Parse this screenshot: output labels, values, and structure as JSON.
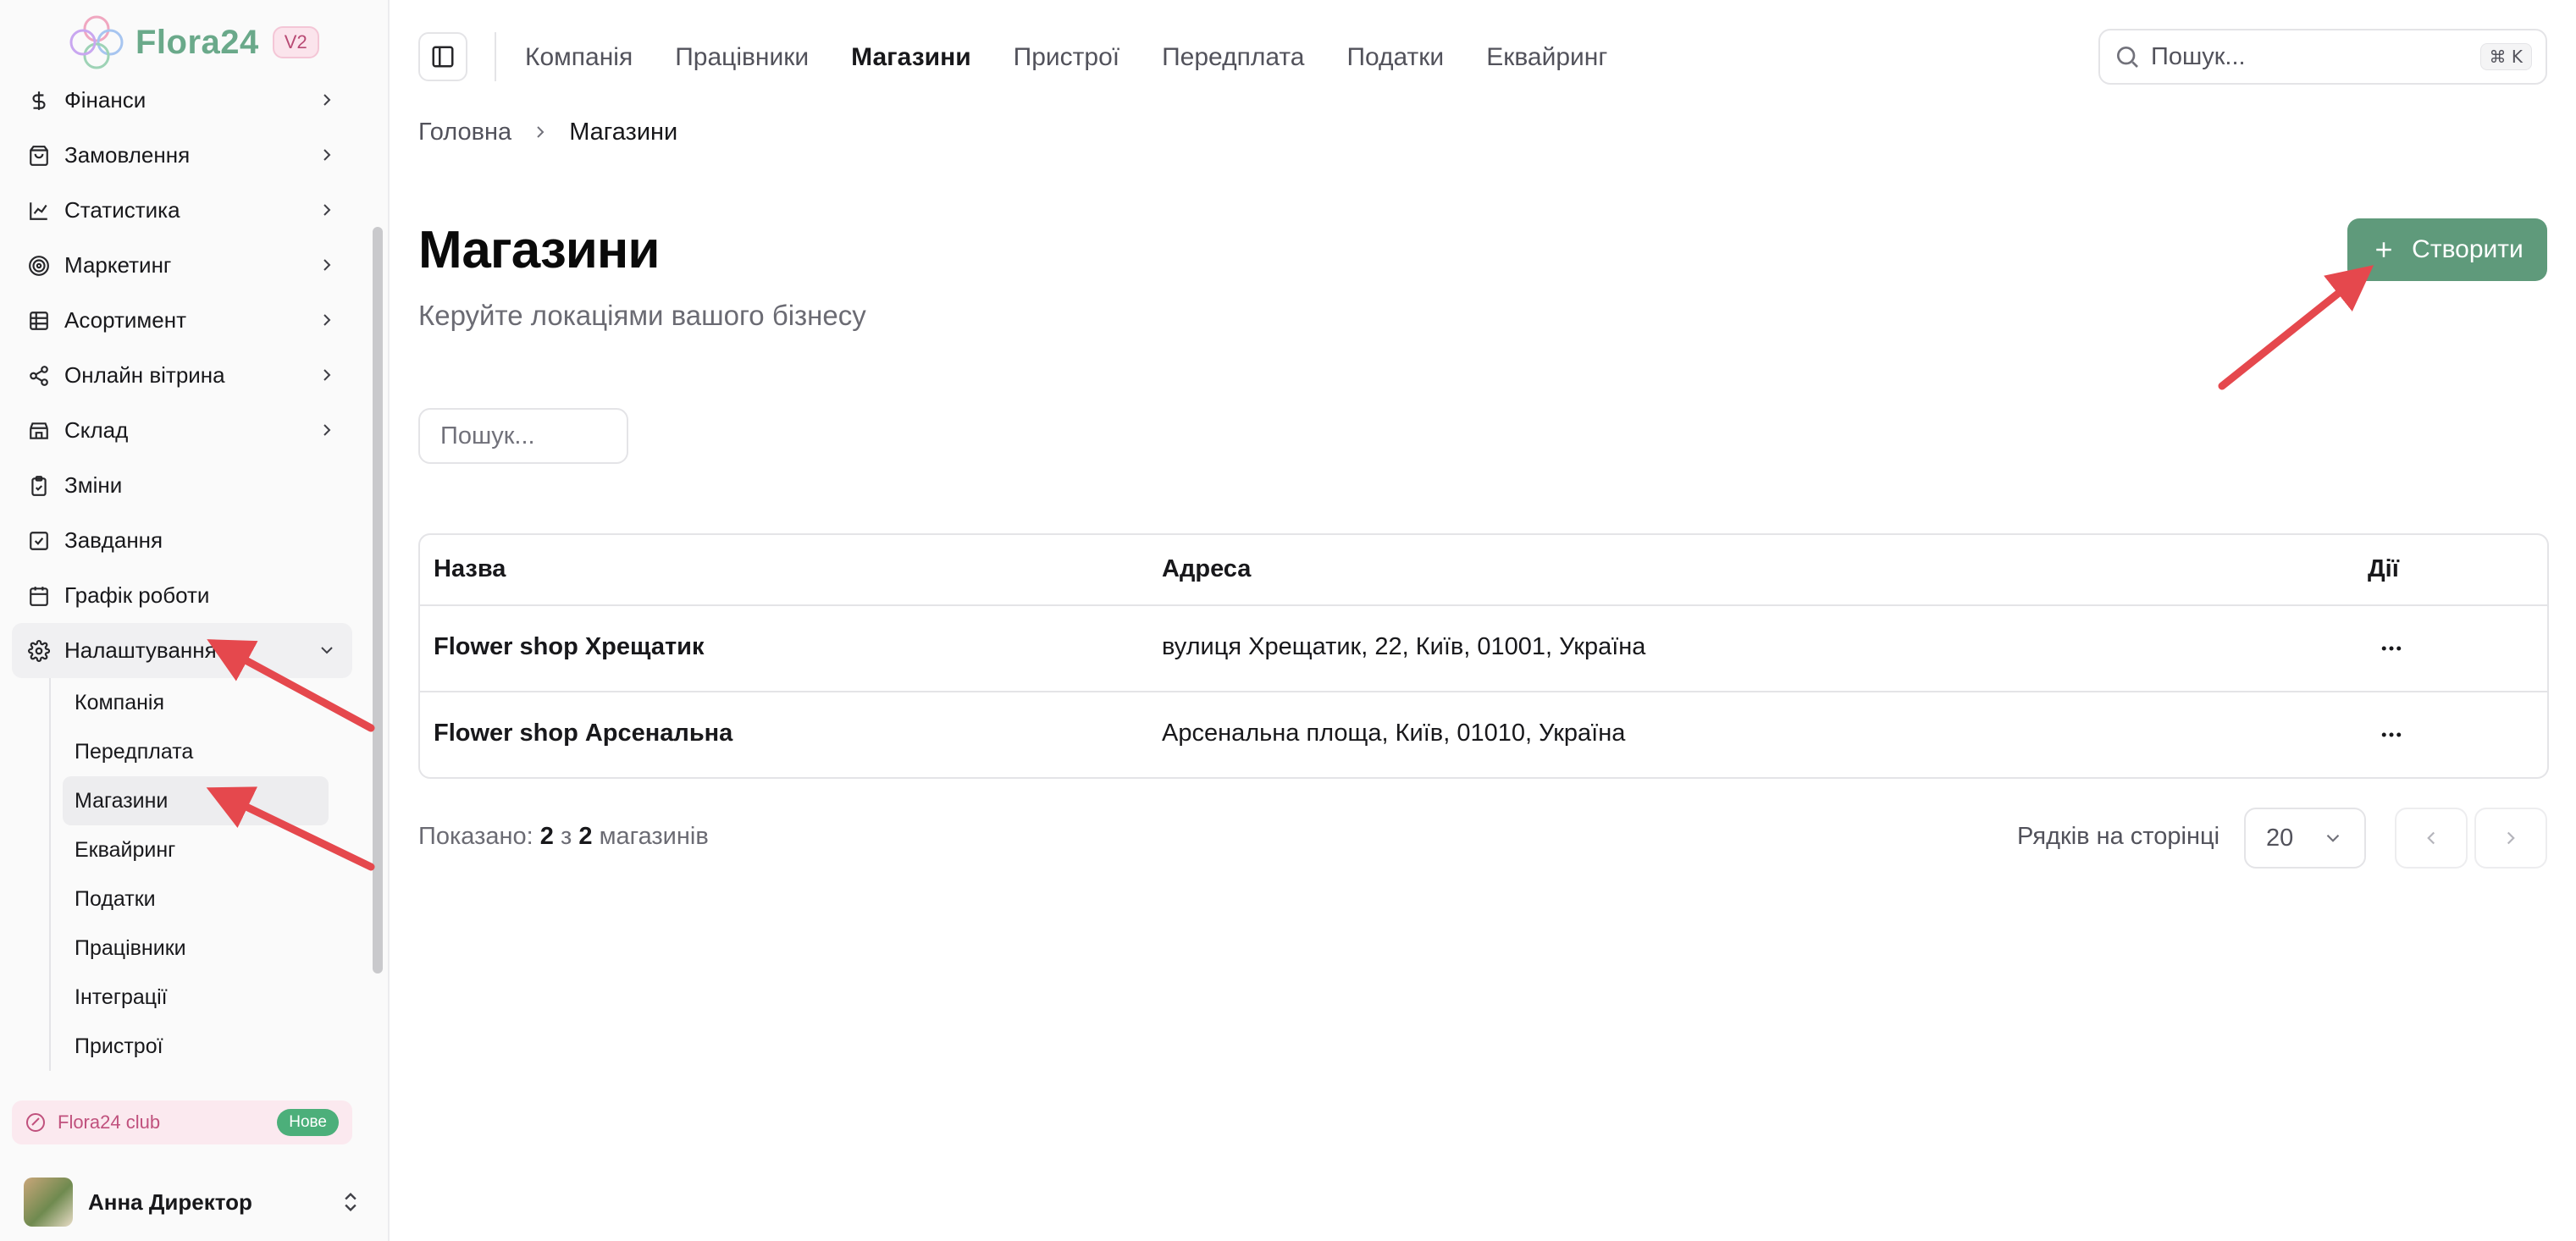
{
  "app": {
    "name": "Flora24",
    "version_badge": "V2"
  },
  "sidebar": {
    "items": [
      {
        "label": "Фінанси",
        "icon": "dollar-icon",
        "has_chevron": true
      },
      {
        "label": "Замовлення",
        "icon": "shopping-bag-icon",
        "has_chevron": true
      },
      {
        "label": "Статистика",
        "icon": "line-chart-icon",
        "has_chevron": true
      },
      {
        "label": "Маркетинг",
        "icon": "target-icon",
        "has_chevron": true
      },
      {
        "label": "Асортимент",
        "icon": "grid-table-icon",
        "has_chevron": true
      },
      {
        "label": "Онлайн вітрина",
        "icon": "share-icon",
        "has_chevron": true
      },
      {
        "label": "Склад",
        "icon": "store-icon",
        "has_chevron": true
      },
      {
        "label": "Зміни",
        "icon": "clipboard-check-icon",
        "has_chevron": false
      },
      {
        "label": "Завдання",
        "icon": "checkbox-icon",
        "has_chevron": false
      },
      {
        "label": "Графік роботи",
        "icon": "calendar-icon",
        "has_chevron": false
      },
      {
        "label": "Налаштування",
        "icon": "gear-icon",
        "has_chevron": true,
        "expanded": true
      }
    ],
    "settings_sub": [
      "Компанія",
      "Передплата",
      "Магазини",
      "Еквайринг",
      "Податки",
      "Працівники",
      "Інтеграції",
      "Пристрої"
    ],
    "active_sub": "Магазини",
    "club": {
      "label": "Flora24 club",
      "badge": "Нове"
    },
    "user": {
      "name": "Анна Директор"
    }
  },
  "topnav": {
    "tabs": [
      "Компанія",
      "Працівники",
      "Магазини",
      "Пристрої",
      "Передплата",
      "Податки",
      "Еквайринг"
    ],
    "active": "Магазини",
    "search_placeholder": "Пошук...",
    "shortcut": "⌘ K"
  },
  "breadcrumb": {
    "home": "Головна",
    "current": "Магазини"
  },
  "page": {
    "title": "Магазини",
    "subtitle": "Керуйте локаціями вашого бізнесу",
    "create_label": "Створити",
    "filter_placeholder": "Пошук..."
  },
  "table": {
    "headers": {
      "name": "Назва",
      "address": "Адреса",
      "actions": "Дії"
    },
    "rows": [
      {
        "name": "Flower shop Хрещатик",
        "address": "вулиця Хрещатик, 22, Київ, 01001, Україна"
      },
      {
        "name": "Flower shop Арсенальна",
        "address": "Арсенальна площа, Київ, 01010, Україна"
      }
    ]
  },
  "footer": {
    "shown_prefix": "Показано:",
    "shown_count": "2",
    "shown_of": "з",
    "shown_total": "2",
    "shown_suffix": "магазинів",
    "rows_per_page_label": "Рядків на сторінці",
    "rows_per_page": "20"
  },
  "colors": {
    "accent": "#5f9a7b",
    "annotation": "#e5484d",
    "club_bg": "#fbe9ef",
    "badge_new": "#4caf7a"
  }
}
